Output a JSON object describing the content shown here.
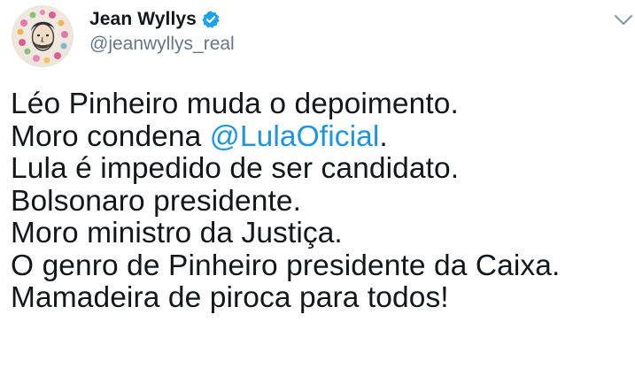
{
  "tweet": {
    "author": {
      "name": "Jean Wyllys",
      "handle": "@jeanwyllys_real",
      "verified": true,
      "avatar_icon": "avatar-portrait-illustration"
    },
    "menu_icon": "chevron-down-icon",
    "lines": [
      {
        "text": "Léo Pinheiro muda o depoimento."
      },
      {
        "before": "Moro condena ",
        "mention": "@LulaOficial",
        "after": "."
      },
      {
        "text": "Lula é impedido de ser candidato."
      },
      {
        "text": "Bolsonaro presidente."
      },
      {
        "text": "Moro ministro da Justiça."
      },
      {
        "text": "O genro de Pinheiro presidente da Caixa."
      },
      {
        "text": "Mamadeira de piroca para todos!"
      }
    ]
  },
  "colors": {
    "text": "#14171a",
    "secondary_text": "#657786",
    "link": "#1b95e0",
    "verified_badge": "#1da1f2",
    "background": "#ffffff"
  }
}
